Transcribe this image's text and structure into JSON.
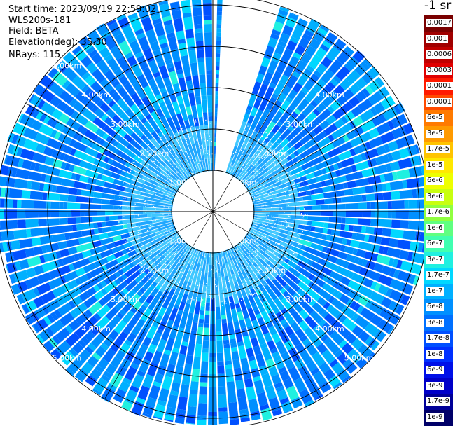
{
  "header": {
    "start_time": "Start time: 2023/09/19 22:59:02",
    "instrument": "WLS200s-181",
    "field": "Field: BETA",
    "elevation": "Elevation(deg): 35.30",
    "nrays": "NRays: 115"
  },
  "colorbar": {
    "title": "-1 sr",
    "labels": [
      "0.0017",
      "0.001",
      "0.0006",
      "0.0003",
      "0.00017",
      "0.0001",
      "6e-5",
      "3e-5",
      "1.7e-5",
      "1e-5",
      "6e-6",
      "3e-6",
      "1.7e-6",
      "1e-6",
      "6e-7",
      "3e-7",
      "1.7e-7",
      "1e-7",
      "6e-8",
      "3e-8",
      "1.7e-8",
      "1e-8",
      "6e-9",
      "3e-9",
      "1.7e-9",
      "1e-9"
    ],
    "colors": [
      "#7a0000",
      "#a00000",
      "#c00000",
      "#e00000",
      "#ff1a00",
      "#ff4a00",
      "#ff7a00",
      "#ff9a00",
      "#ffc400",
      "#ffe800",
      "#eeff00",
      "#c8ff10",
      "#90ff40",
      "#60ff80",
      "#40ffb0",
      "#20f0e0",
      "#00d8ff",
      "#00b0ff",
      "#0090ff",
      "#0070ff",
      "#0050ff",
      "#0030ff",
      "#0010e8",
      "#0000c8",
      "#000098",
      "#000068"
    ]
  },
  "chart_data": {
    "type": "heatmap",
    "projection": "polar PPI scan",
    "field": "BETA",
    "units": "sr-1",
    "elevation_deg": 35.3,
    "n_rays": 115,
    "range_rings_km": [
      1,
      2,
      3,
      4,
      5
    ],
    "ring_labels": [
      "1.00km",
      "2.00km",
      "3.00km",
      "4.00km",
      "5.00km"
    ],
    "max_range_km": 5.2,
    "missing_azimuth_sector_deg": [
      0,
      18
    ],
    "dominant_values": [
      "1.7e-8",
      "1e-8",
      "6e-8",
      "3e-8"
    ],
    "near_range_value": "1e-8",
    "color_scale": "log"
  }
}
